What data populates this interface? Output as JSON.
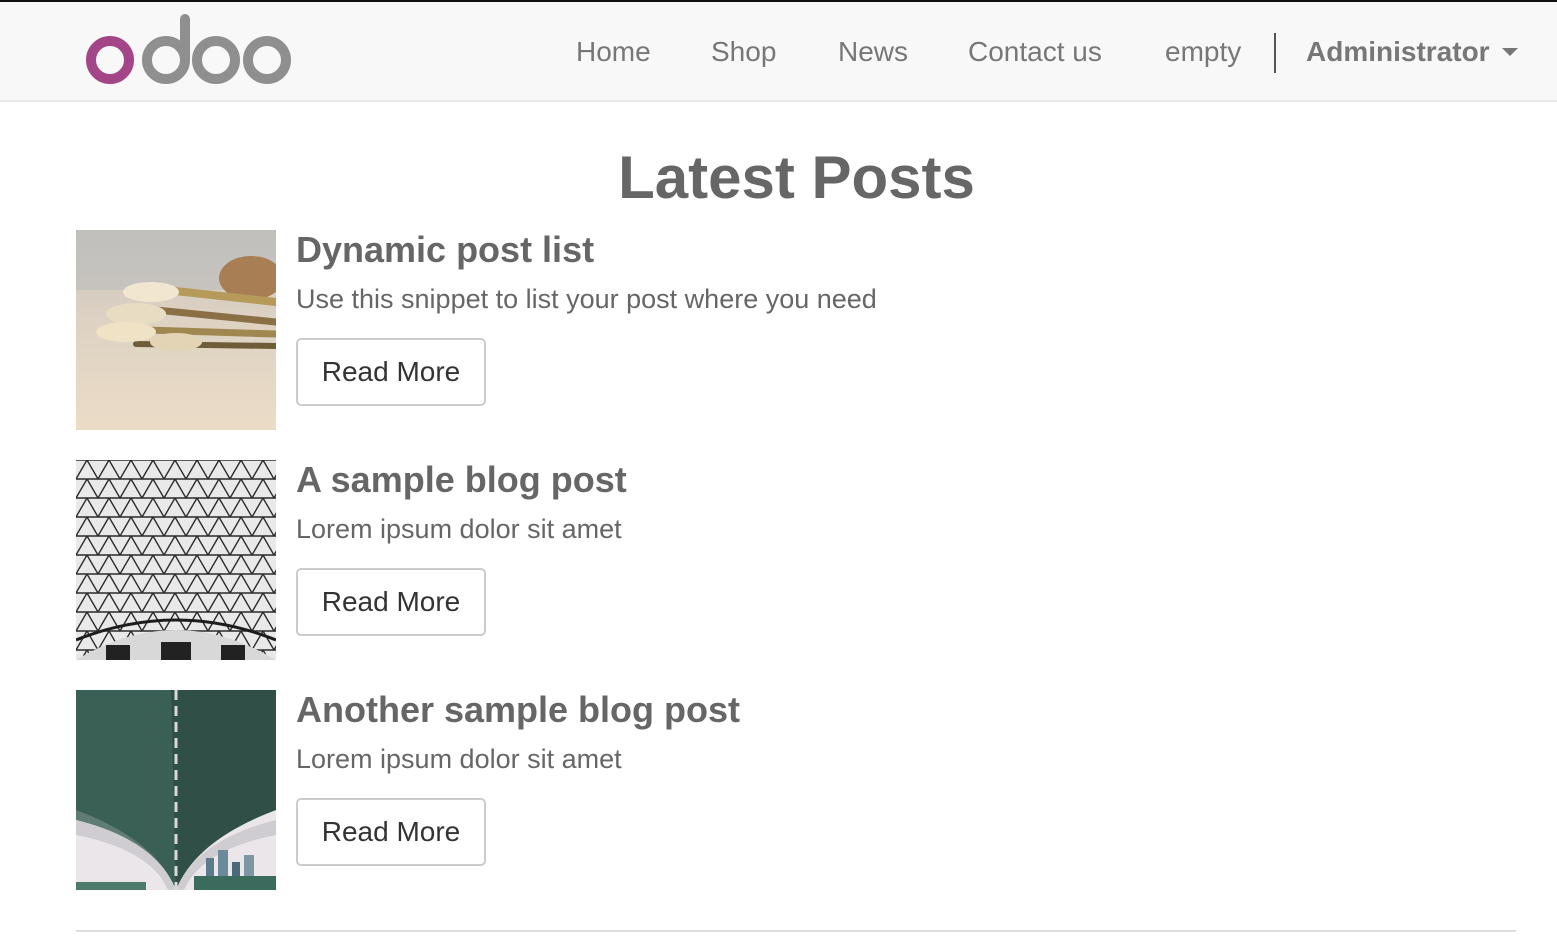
{
  "brand": {
    "name": "odoo",
    "logo_colors": {
      "o_accent": "#a24689",
      "grey": "#8f8f8f"
    }
  },
  "nav": {
    "items": [
      {
        "label": "Home"
      },
      {
        "label": "Shop"
      },
      {
        "label": "News"
      },
      {
        "label": "Contact us"
      },
      {
        "label": "empty"
      }
    ],
    "user": {
      "label": "Administrator",
      "icon": "caret-down-icon"
    }
  },
  "main": {
    "title": "Latest Posts",
    "posts": [
      {
        "title": "Dynamic post list",
        "subtitle": "Use this snippet to list your post where you need",
        "button": "Read More",
        "image": "paint-brushes-photo"
      },
      {
        "title": "A sample blog post",
        "subtitle": "Lorem ipsum dolor sit amet",
        "button": "Read More",
        "image": "glass-roof-photo"
      },
      {
        "title": "Another sample blog post",
        "subtitle": "Lorem ipsum dolor sit amet",
        "button": "Read More",
        "image": "bridge-underside-photo"
      }
    ]
  },
  "colors": {
    "navbar_bg": "#f8f8f8",
    "text": "#666666",
    "nav_text": "#777777",
    "button_border": "#cccccc"
  }
}
